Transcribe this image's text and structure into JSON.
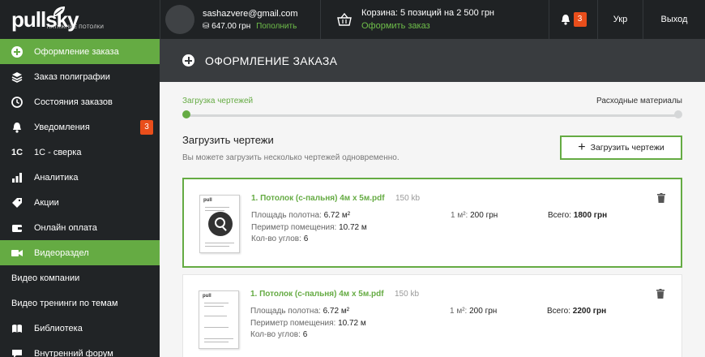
{
  "logo": {
    "text": "pullsky",
    "subtitle": "НАТЯЖНЫЕ ПОТОЛКИ"
  },
  "user": {
    "email": "sashazvere@gmail.com",
    "balance": "647.00 грн",
    "topup_label": "Пополнить"
  },
  "cart": {
    "summary": "Корзина: 5 позиций на 2 500 грн",
    "checkout_label": "Оформить заказ"
  },
  "notifications": {
    "count": "3"
  },
  "language": "Укр",
  "logout_label": "Выход",
  "sidebar": {
    "items": [
      {
        "label": "Оформление заказа",
        "icon": "plus-circle-icon",
        "active": true
      },
      {
        "label": "Заказ полиграфии",
        "icon": "layers-icon"
      },
      {
        "label": "Состояния заказов",
        "icon": "clock-icon"
      },
      {
        "label": "Уведомления",
        "icon": "bell-icon",
        "badge": "3"
      },
      {
        "label": "1С - сверка",
        "icon": "1c-icon"
      },
      {
        "label": "Аналитика",
        "icon": "bar-chart-icon"
      },
      {
        "label": "Акции",
        "icon": "tag-icon"
      },
      {
        "label": "Онлайн оплата",
        "icon": "wallet-icon"
      },
      {
        "label": "Видеораздел",
        "icon": "video-camera-icon",
        "active": true
      },
      {
        "label": "Видео компании",
        "sub": true
      },
      {
        "label": "Видео тренинги по темам",
        "sub": true
      },
      {
        "label": "Библиотека",
        "icon": "book-icon"
      },
      {
        "label": "Внутренний форум",
        "icon": "chat-icon"
      }
    ]
  },
  "page": {
    "title": "ОФОРМЛЕНИЕ ЗАКАЗА",
    "steps": {
      "current": "Загрузка чертежей",
      "next": "Расходные материалы"
    },
    "upload": {
      "title": "Загрузить чертежи",
      "hint": "Вы можете загрузить несколько чертежей одновременно.",
      "button_label": "Загрузить чертежи"
    },
    "files": [
      {
        "name": "1. Потолок (с-пальня) 4м х 5м.pdf",
        "size": "150 kb",
        "area_label": "Площадь полотна:",
        "area": "6.72 м²",
        "perimeter_label": "Периметр помещения:",
        "perimeter": "10.72 м",
        "corners_label": "Кол-во углов:",
        "corners": "6",
        "price_label": "1 м²:",
        "price": "200 грн",
        "total_label": "Всего:",
        "total": "1800 грн",
        "selected": true
      },
      {
        "name": "1. Потолок (с-пальня) 4м х 5м.pdf",
        "size": "150 kb",
        "area_label": "Площадь полотна:",
        "area": "6.72 м²",
        "perimeter_label": "Периметр помещения:",
        "perimeter": "10.72 м",
        "corners_label": "Кол-во углов:",
        "corners": "6",
        "price_label": "1 м²:",
        "price": "200 грн",
        "total_label": "Всего:",
        "total": "2200 грн",
        "selected": false
      }
    ]
  },
  "colors": {
    "accent": "#65ab43",
    "badge": "#e94e1b",
    "topbar": "#1f2224",
    "sidebar": "#212426",
    "header": "#393c3f"
  }
}
